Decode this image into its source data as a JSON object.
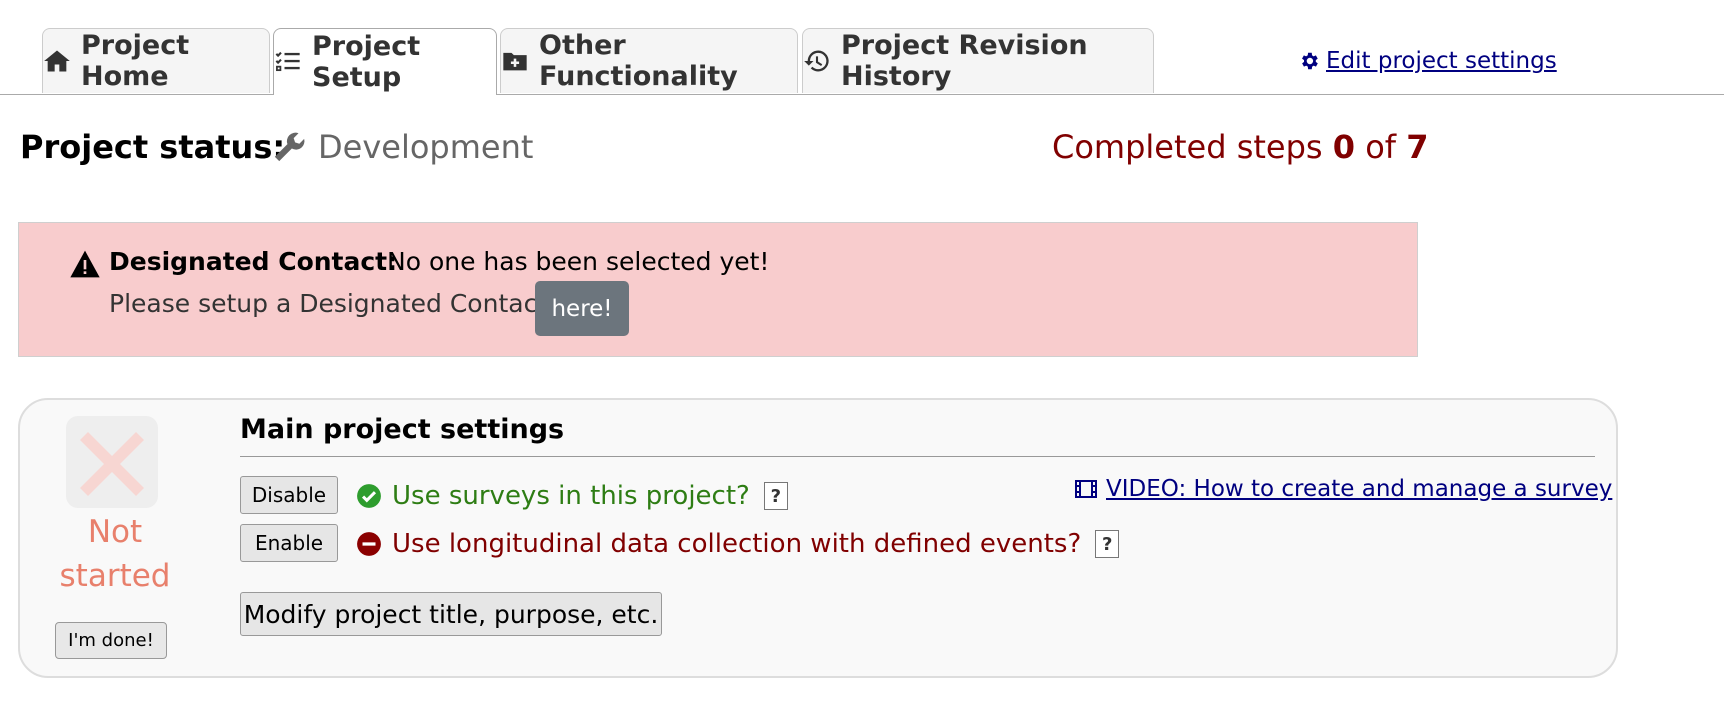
{
  "tabs": {
    "home": {
      "label": "Project Home",
      "icon": "home-icon"
    },
    "setup": {
      "label": "Project Setup",
      "icon": "tasks-list-icon"
    },
    "other": {
      "label": "Other Functionality",
      "icon": "folder-plus-icon"
    },
    "history": {
      "label": "Project Revision History",
      "icon": "history-icon"
    },
    "settings_link": {
      "label": "Edit project settings",
      "icon": "gear-icon"
    }
  },
  "status": {
    "label": "Project status:",
    "value": "Development",
    "icon": "wrench-icon"
  },
  "completed": {
    "prefix": "Completed steps ",
    "done": "0",
    "of": " of ",
    "total": "7",
    "color": "#800000"
  },
  "alert": {
    "title": "Designated Contact:",
    "message": "No one has been selected yet!",
    "line2": "Please setup a Designated Contact",
    "button": "here!",
    "background": "#f8cccd",
    "icon": "warning-icon"
  },
  "step": {
    "status_line1": "Not",
    "status_line2": "started",
    "done_button": "I'm done!",
    "title": "Main project settings",
    "options": [
      {
        "button": "Disable",
        "text": "Use surveys in this project?",
        "state": "enabled",
        "icon": "check-circle-icon",
        "color": "#2e7d14"
      },
      {
        "button": "Enable",
        "text": "Use longitudinal data collection with defined events?",
        "state": "disabled",
        "icon": "minus-circle-icon",
        "color": "#800000"
      }
    ],
    "help_label": "?",
    "video_link": "VIDEO: How to create and manage a survey",
    "modify_button": "Modify project title, purpose, etc."
  }
}
